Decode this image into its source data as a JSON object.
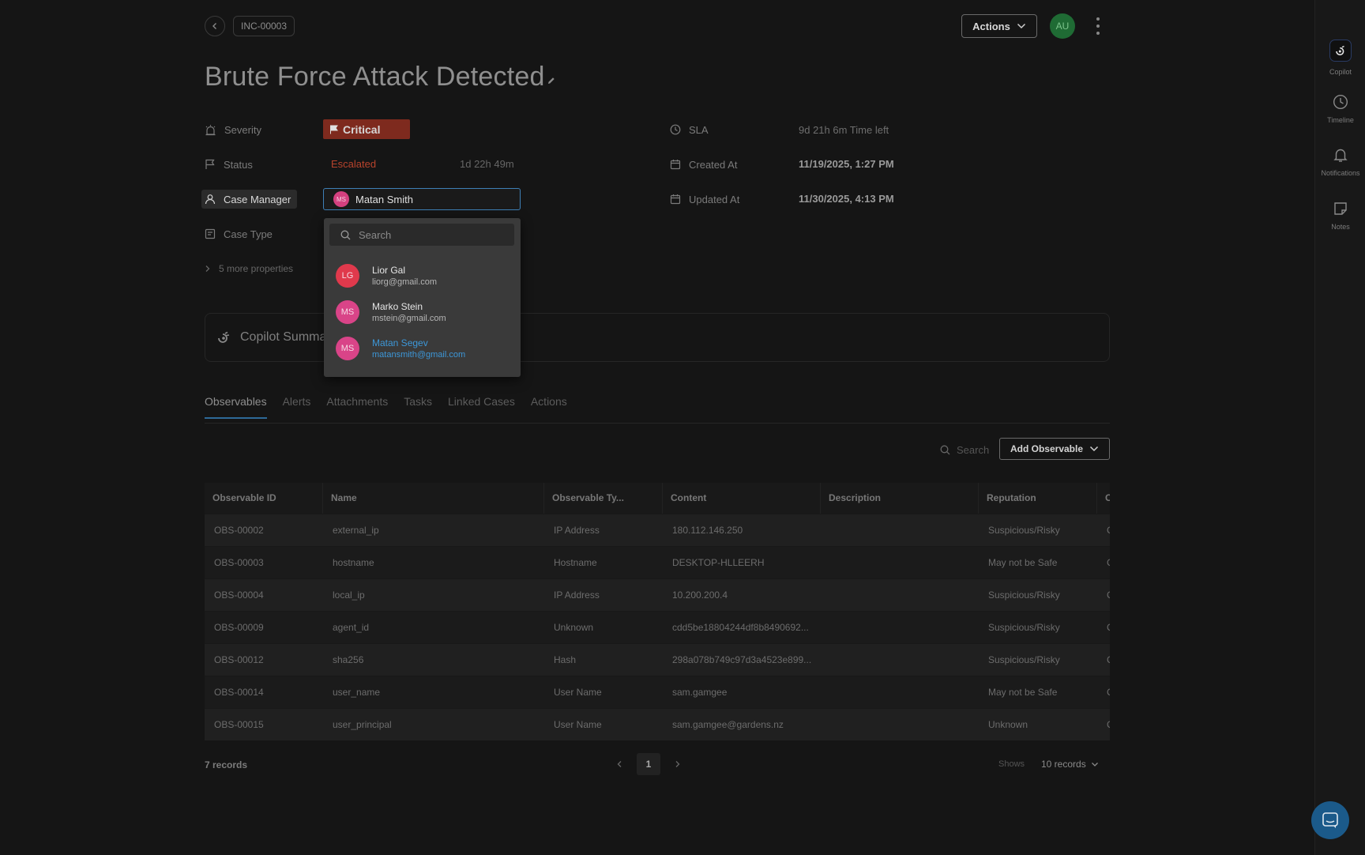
{
  "header": {
    "incident_id": "INC-00003",
    "actions_label": "Actions",
    "user_initials": "AU",
    "title": "Brute Force Attack Detected"
  },
  "properties": {
    "severity_label": "Severity",
    "severity_value": "Critical",
    "status_label": "Status",
    "status_value": "Escalated",
    "status_duration": "1d 22h 49m",
    "case_manager_label": "Case Manager",
    "case_manager_value": "Matan Smith",
    "case_manager_initials": "MS",
    "case_type_label": "Case Type",
    "more_properties": "5 more properties",
    "sla_label": "SLA",
    "sla_value": "9d 21h 6m  Time left",
    "created_label": "Created At",
    "created_value": "11/19/2025, 1:27 PM",
    "updated_label": "Updated At",
    "updated_value": "11/30/2025, 4:13 PM"
  },
  "dropdown": {
    "search_placeholder": "Search",
    "options": [
      {
        "initials": "LG",
        "name": "Lior Gal",
        "email": "liorg@gmail.com",
        "color": "#e0394c"
      },
      {
        "initials": "MS",
        "name": "Marko Stein",
        "email": "mstein@gmail.com",
        "color": "#d94488"
      },
      {
        "initials": "MS",
        "name": "Matan Segev",
        "email": "matansmith@gmail.com",
        "color": "#d94488"
      }
    ]
  },
  "copilot": {
    "label": "Copilot Summa"
  },
  "tabs": [
    "Observables",
    "Alerts",
    "Attachments",
    "Tasks",
    "Linked Cases",
    "Actions"
  ],
  "toolbar": {
    "search_placeholder": "Search",
    "add_label": "Add Observable"
  },
  "table": {
    "headers": [
      "Observable ID",
      "Name",
      "Observable Ty...",
      "Content",
      "Description",
      "Reputation",
      "C"
    ],
    "rows": [
      [
        "OBS-00002",
        "external_ip",
        "IP Address",
        "180.112.146.250",
        "",
        "Suspicious/Risky",
        "C"
      ],
      [
        "OBS-00003",
        "hostname",
        "Hostname",
        "DESKTOP-HLLEERH",
        "",
        "May not be Safe",
        "C"
      ],
      [
        "OBS-00004",
        "local_ip",
        "IP Address",
        "10.200.200.4",
        "",
        "Suspicious/Risky",
        "C"
      ],
      [
        "OBS-00009",
        "agent_id",
        "Unknown",
        "cdd5be18804244df8b8490692...",
        "",
        "Suspicious/Risky",
        "C"
      ],
      [
        "OBS-00012",
        "sha256",
        "Hash",
        "298a078b749c97d3a4523e899...",
        "",
        "Suspicious/Risky",
        "C"
      ],
      [
        "OBS-00014",
        "user_name",
        "User Name",
        "sam.gamgee",
        "",
        "May not be Safe",
        "C"
      ],
      [
        "OBS-00015",
        "user_principal",
        "User Name",
        "sam.gamgee@gardens.nz",
        "",
        "Unknown",
        "C"
      ]
    ]
  },
  "footer": {
    "records": "7 records",
    "page": "1",
    "shows_label": "Shows",
    "per_page": "10 records"
  },
  "rail": {
    "copilot": "Copilot",
    "timeline": "Timeline",
    "notifications": "Notifications",
    "notes": "Notes"
  },
  "colors": {
    "critical": "#7e2a1e",
    "escalated": "#b8432c",
    "accent": "#3d97d8"
  }
}
